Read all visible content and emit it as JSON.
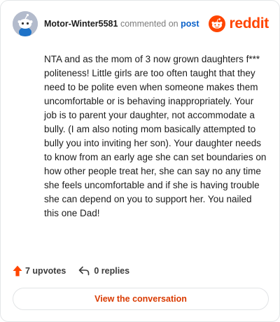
{
  "header": {
    "username": "Motor-Winter5581",
    "action_text": "commented on",
    "target_text": "post",
    "brand_name": "reddit",
    "brand_color": "#ff4500",
    "avatar_icon": "snoo-avatar-icon",
    "logo_icon": "reddit-snoo-icon"
  },
  "comment": {
    "text": "NTA and as the mom of 3 now grown daughters f*** politeness! Little girls are too often taught that they need to be polite even when someone makes them uncomfortable or is behaving inappropriately. Your job is to parent your daughter, not accommodate a bully. (I am also noting mom basically attempted to bully you into inviting her son). Your daughter needs to know from an early age she can set boundaries on how other people treat her, she can say no any time she feels uncomfortable and if she is having trouble she can depend on you to support her. You nailed this one Dad!"
  },
  "stats": {
    "upvotes_label": "7 upvotes",
    "replies_label": "0 replies",
    "upvote_icon": "upvote-arrow-icon",
    "reply_icon": "reply-arrow-icon",
    "upvote_color": "#ff4500"
  },
  "cta": {
    "label": "View the conversation",
    "color": "#d93a00"
  }
}
